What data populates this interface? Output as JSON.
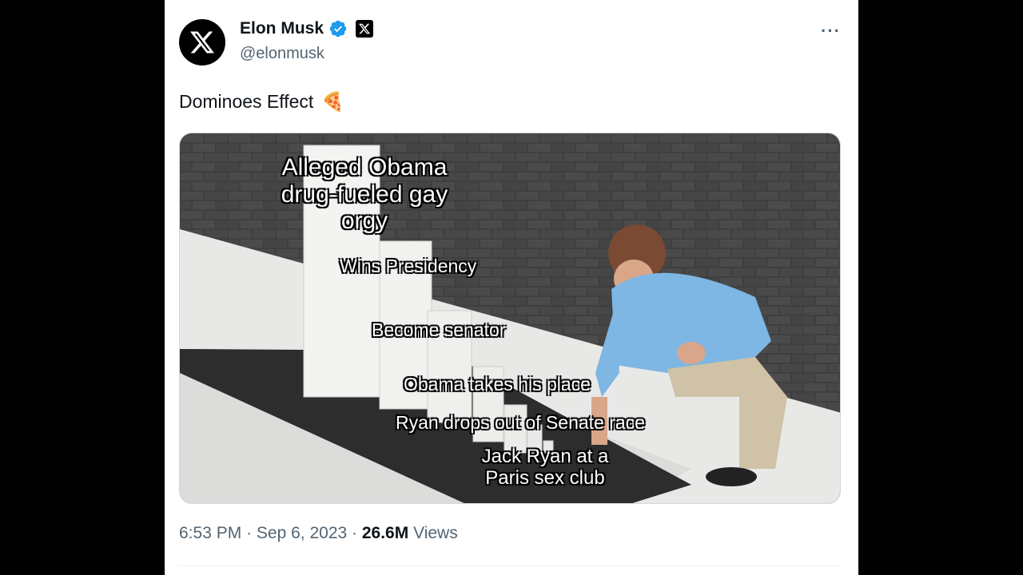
{
  "author": {
    "display_name": "Elon Musk",
    "handle": "@elonmusk"
  },
  "tweet": {
    "text": "Dominoes Effect",
    "emoji": "🍕",
    "time": "6:53 PM",
    "date": "Sep 6, 2023",
    "views_count": "26.6M",
    "views_label": "Views",
    "separator": "·"
  },
  "more_menu": "···",
  "meme": {
    "labels": [
      "Alleged Obama\ndrug-fueled gay\norgy",
      "Wins Presidency",
      "Become senator",
      "Obama takes his place",
      "Ryan drops out of Senate race",
      "Jack Ryan at a\nParis sex club"
    ]
  },
  "colors": {
    "verified": "#1d9bf0",
    "text": "#0f1419",
    "secondary": "#536471"
  }
}
